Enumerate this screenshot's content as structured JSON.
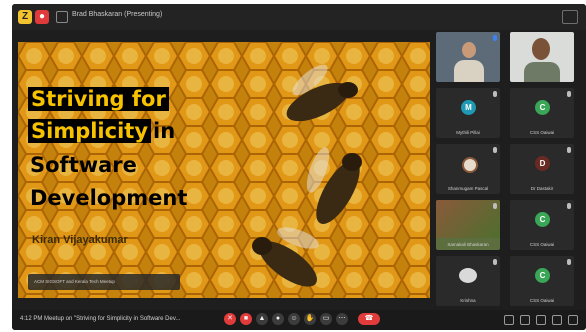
{
  "window": {
    "title": "Brad Bhaskaran (Presenting)"
  },
  "slide": {
    "title_lines": [
      "Striving for",
      "Simplicity",
      "in",
      "Software",
      "Development"
    ],
    "author": "Kiran Vijayakumar",
    "caption": "ACM SIGSOFT and Kerala Tech Meetup"
  },
  "participants": [
    {
      "name": "",
      "initial": "",
      "avatar_color": "#000000"
    },
    {
      "name": "",
      "initial": "",
      "avatar_color": "#000000"
    },
    {
      "name": "Mythili Pillai",
      "initial": "M",
      "avatar_color": "#1e9ab4"
    },
    {
      "name": "CSS Oaiwai",
      "initial": "C",
      "avatar_color": "#3aa657"
    },
    {
      "name": "Shanmugam Pascal",
      "initial": "",
      "avatar_color": "#000000"
    },
    {
      "name": "Dr Dastakir",
      "initial": "D",
      "avatar_color": "#6a2a24"
    },
    {
      "name": "Samakali Bhaskaran",
      "initial": "",
      "avatar_color": "#000000"
    },
    {
      "name": "CSS Oaiwai",
      "initial": "C",
      "avatar_color": "#3aa657"
    },
    {
      "name": "Krishna",
      "initial": "",
      "avatar_color": "#000000"
    },
    {
      "name": "CSS Oaiwai",
      "initial": "C",
      "avatar_color": "#3aa657"
    }
  ],
  "toolbar": {
    "time": "4:12 PM",
    "meeting_name": "Meetup on \"Striving for Simplicity in Software Dev...",
    "leave_icon": "phone-end-icon"
  },
  "colors": {
    "accent_yellow": "#f4c430",
    "alert_red": "#e23b3b",
    "slide_title_highlight": "#f7c200"
  }
}
